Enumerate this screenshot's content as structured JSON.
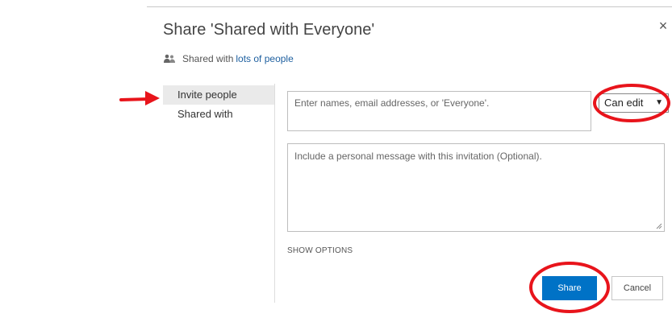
{
  "dialog": {
    "title": "Share 'Shared with Everyone'",
    "close_icon": "close-icon",
    "close_glyph": "×"
  },
  "shared_status": {
    "icon": "people-icon",
    "prefix": "Shared with",
    "link_text": "lots of people"
  },
  "nav": {
    "items": [
      {
        "label": "Invite people",
        "active": true
      },
      {
        "label": "Shared with",
        "active": false
      }
    ]
  },
  "invite": {
    "names_placeholder": "Enter names, email addresses, or 'Everyone'.",
    "permission": {
      "selected": "Can edit",
      "caret_icon": "triangle-down-icon",
      "caret_glyph": "▼"
    },
    "message_placeholder": "Include a personal message with this invitation (Optional).",
    "show_options_label": "SHOW OPTIONS"
  },
  "actions": {
    "share_label": "Share",
    "cancel_label": "Cancel"
  },
  "annotations": {
    "color": "#e8141b"
  }
}
